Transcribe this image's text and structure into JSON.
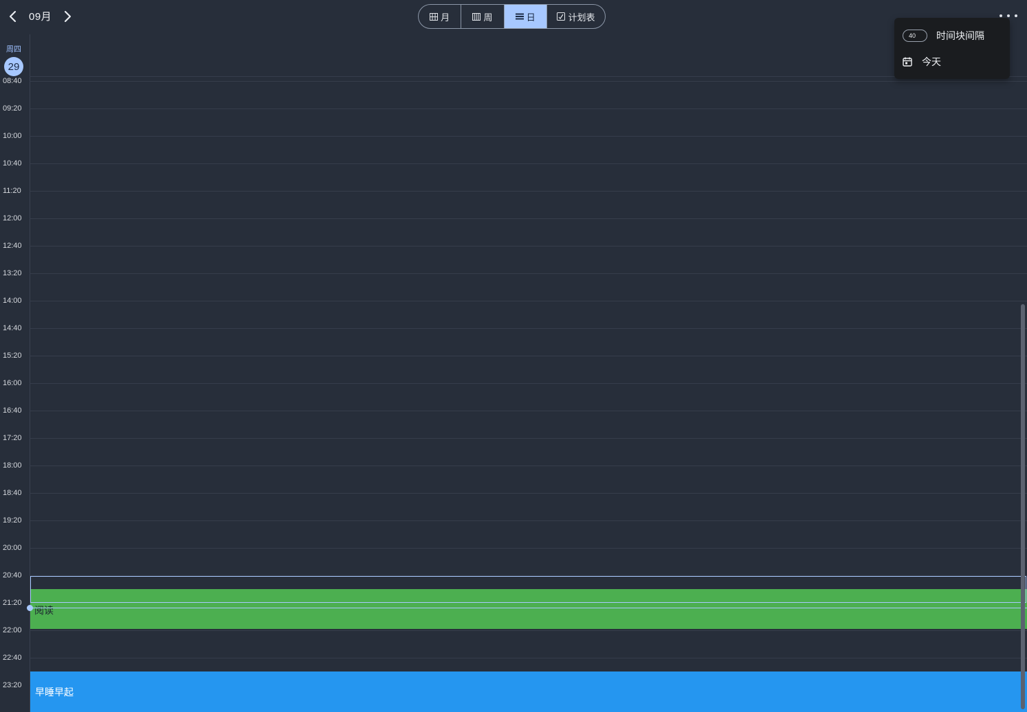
{
  "header": {
    "month": "09月",
    "prev_icon": "chevron-left-icon",
    "next_icon": "chevron-right-icon",
    "more_icon": "more-horizontal-icon"
  },
  "view_tabs": [
    {
      "label": "月",
      "icon": "grid-icon",
      "active": false
    },
    {
      "label": "周",
      "icon": "columns-icon",
      "active": false
    },
    {
      "label": "日",
      "icon": "list-icon",
      "active": true
    },
    {
      "label": "计划表",
      "icon": "plan-icon",
      "active": false
    }
  ],
  "day": {
    "weekday": "周四",
    "date": "29"
  },
  "time_labels": [
    "08:40",
    "09:20",
    "10:00",
    "10:40",
    "11:20",
    "12:00",
    "12:40",
    "13:20",
    "14:00",
    "14:40",
    "15:20",
    "16:00",
    "16:40",
    "17:20",
    "18:00",
    "18:40",
    "19:20",
    "20:00",
    "20:40",
    "21:20",
    "22:00",
    "22:40",
    "23:20"
  ],
  "events": [
    {
      "title": "阅读",
      "color": "#4caf50"
    },
    {
      "title": "早睡早起",
      "color": "#2596f0"
    }
  ],
  "menu": {
    "interval_value": "40",
    "interval_label": "时间块间隔",
    "today_label": "今天",
    "today_icon": "calendar-icon"
  },
  "colors": {
    "background": "#272e3a",
    "accent": "#a7c8ff",
    "popup": "#1a1c1f"
  }
}
